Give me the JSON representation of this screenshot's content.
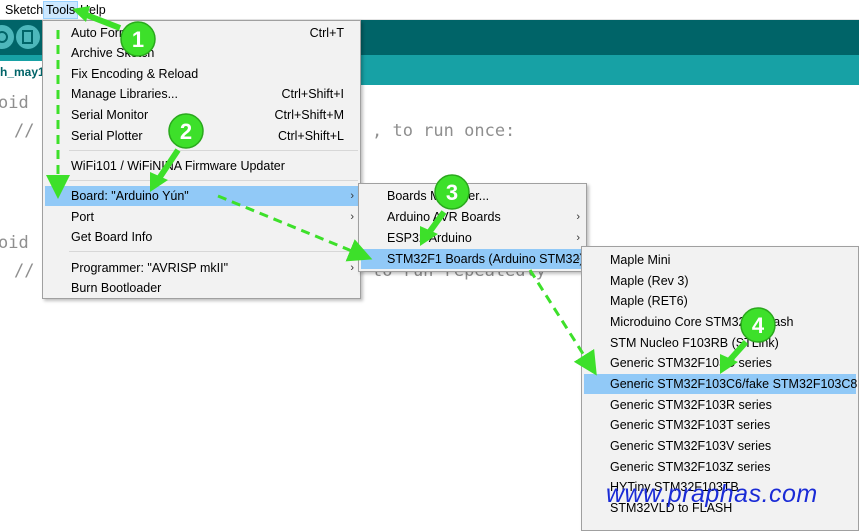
{
  "menubar": {
    "items": [
      "Sketch",
      "Tools",
      "Help"
    ]
  },
  "sketch_tab": {
    "label": "h_may1"
  },
  "editor": {
    "lines": [
      "oid",
      "//",
      ", to run once:",
      "oid",
      "//",
      "to run repeatedly"
    ]
  },
  "tools_menu": {
    "items": [
      {
        "label": "Auto Format",
        "shortcut": "Ctrl+T"
      },
      {
        "label": "Archive Sketch",
        "shortcut": ""
      },
      {
        "label": "Fix Encoding & Reload",
        "shortcut": ""
      },
      {
        "label": "Manage Libraries...",
        "shortcut": "Ctrl+Shift+I"
      },
      {
        "label": "Serial Monitor",
        "shortcut": "Ctrl+Shift+M"
      },
      {
        "label": "Serial Plotter",
        "shortcut": "Ctrl+Shift+L"
      },
      {
        "label": "WiFi101 / WiFiNINA Firmware Updater",
        "shortcut": ""
      },
      {
        "label": "Board: \"Arduino Yún\"",
        "shortcut": ""
      },
      {
        "label": "Port",
        "shortcut": ""
      },
      {
        "label": "Get Board Info",
        "shortcut": ""
      },
      {
        "label": "Programmer: \"AVRISP mkII\"",
        "shortcut": ""
      },
      {
        "label": "Burn Bootloader",
        "shortcut": ""
      }
    ],
    "submenu_arrow": "›"
  },
  "board_menu": {
    "items": [
      "Boards Manager...",
      "Arduino AVR Boards",
      "ESP32 Arduino",
      "STM32F1 Boards (Arduino STM32)"
    ]
  },
  "stm32_menu": {
    "items": [
      "Maple Mini",
      "Maple (Rev 3)",
      "Maple (RET6)",
      "Microduino Core STM32 to Flash",
      "STM Nucleo F103RB (STLink)",
      "Generic STM32F103C series",
      "Generic STM32F103C6/fake STM32F103C8",
      "Generic STM32F103R series",
      "Generic STM32F103T series",
      "Generic STM32F103V series",
      "Generic STM32F103Z series",
      "HYTiny STM32F103TB",
      "STM32VLD to FLASH"
    ]
  },
  "annotations": {
    "steps": [
      "1",
      "2",
      "3",
      "4"
    ],
    "color": "#3de02a"
  },
  "watermark": {
    "text": "www.praphas.com",
    "color": "#1a2bd6"
  },
  "colors": {
    "toolbar": "#006468",
    "tabbar": "#17a1a5",
    "highlight": "#91c9f7",
    "menu_bg": "#f2f2f2"
  }
}
